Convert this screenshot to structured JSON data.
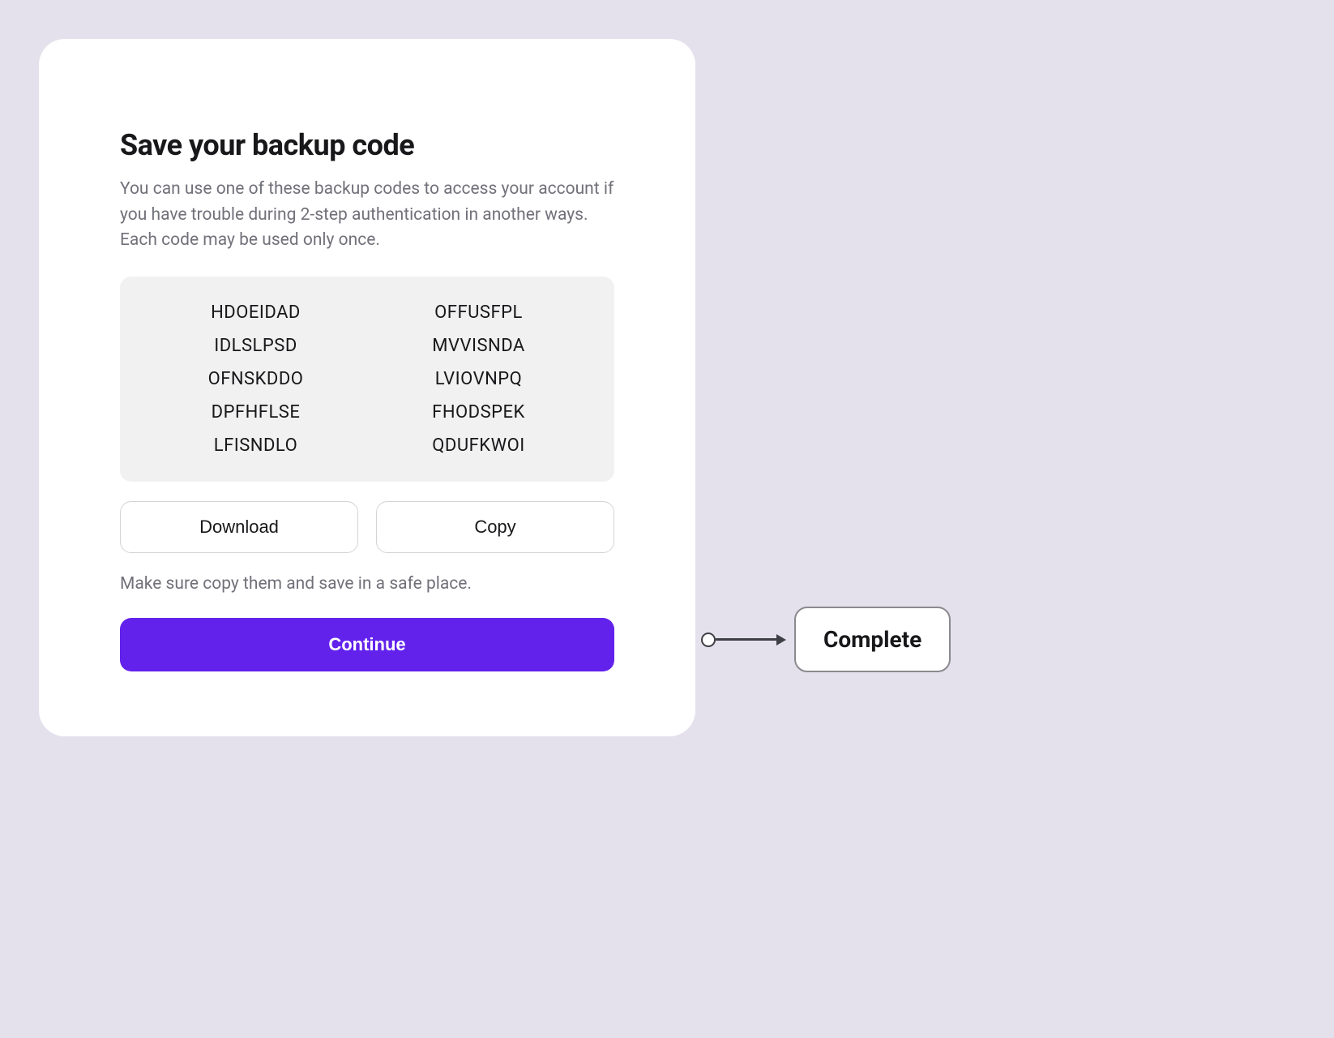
{
  "card": {
    "title": "Save your backup code",
    "description": "You can use one of these backup codes to access your account if you have trouble during 2-step authentication in another ways. Each code may be used only once.",
    "codes": {
      "left": [
        "HDOEIDAD",
        "IDLSLPSD",
        "OFNSKDDO",
        "DPFHFLSE",
        "LFISNDLO"
      ],
      "right": [
        "OFFUSFPL",
        "MVVISNDA",
        "LVIOVNPQ",
        "FHODSPEK",
        "QDUFKWOI"
      ]
    },
    "downloadLabel": "Download",
    "copyLabel": "Copy",
    "hint": "Make sure copy them and save in a safe place.",
    "continueLabel": "Continue"
  },
  "annotation": {
    "label": "Complete"
  }
}
